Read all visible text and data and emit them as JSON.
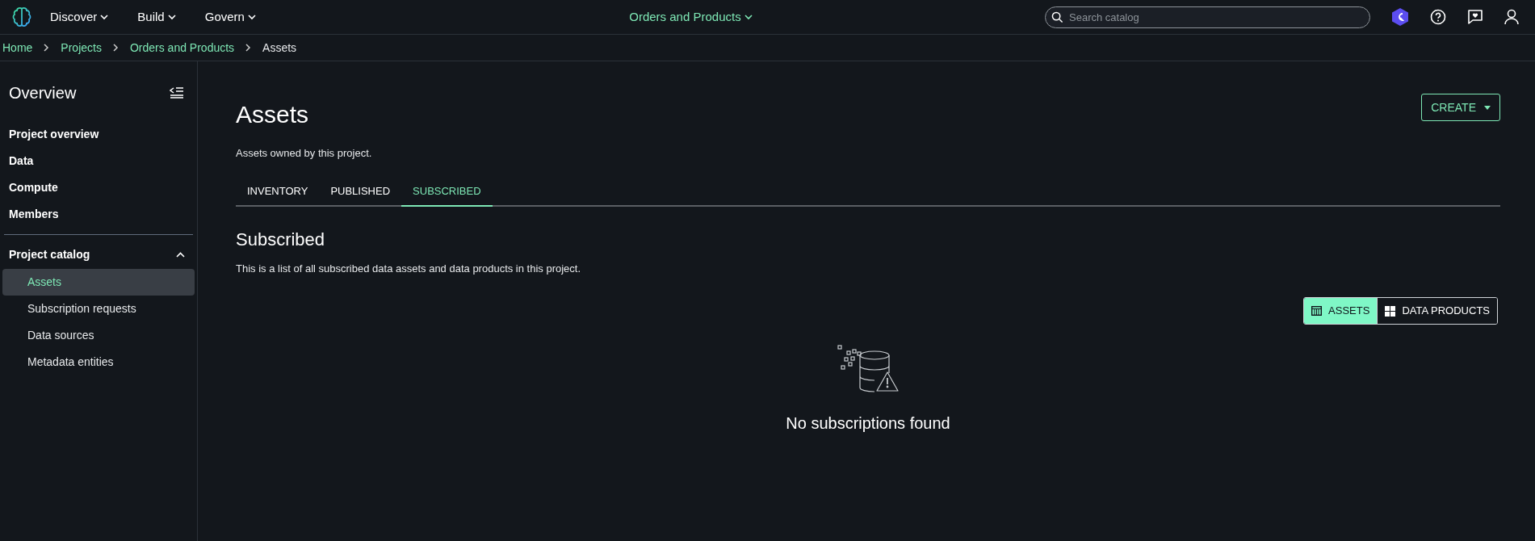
{
  "top_nav": {
    "menus": [
      {
        "label": "Discover"
      },
      {
        "label": "Build"
      },
      {
        "label": "Govern"
      }
    ],
    "project_switcher": "Orders and Products",
    "search": {
      "placeholder": "Search catalog"
    }
  },
  "breadcrumbs": [
    {
      "label": "Home",
      "link": true
    },
    {
      "label": "Projects",
      "link": true
    },
    {
      "label": "Orders and Products",
      "link": true
    },
    {
      "label": "Assets",
      "link": false
    }
  ],
  "sidebar": {
    "title": "Overview",
    "items": [
      {
        "label": "Project overview"
      },
      {
        "label": "Data"
      },
      {
        "label": "Compute"
      },
      {
        "label": "Members"
      }
    ],
    "section": {
      "label": "Project catalog",
      "expanded": true,
      "children": [
        {
          "label": "Assets",
          "selected": true
        },
        {
          "label": "Subscription requests",
          "selected": false
        },
        {
          "label": "Data sources",
          "selected": false
        },
        {
          "label": "Metadata entities",
          "selected": false
        }
      ]
    }
  },
  "page": {
    "title": "Assets",
    "subtitle": "Assets owned by this project.",
    "create_button": "CREATE",
    "tabs": [
      {
        "label": "INVENTORY",
        "selected": false
      },
      {
        "label": "PUBLISHED",
        "selected": false
      },
      {
        "label": "SUBSCRIBED",
        "selected": true
      }
    ],
    "section_title": "Subscribed",
    "section_description": "This is a list of all subscribed data assets and data products in this project.",
    "view_toggle": [
      {
        "label": "ASSETS",
        "kind": "table",
        "selected": true
      },
      {
        "label": "DATA PRODUCTS",
        "kind": "grid",
        "selected": false
      }
    ],
    "empty_state": "No subscriptions found"
  }
}
